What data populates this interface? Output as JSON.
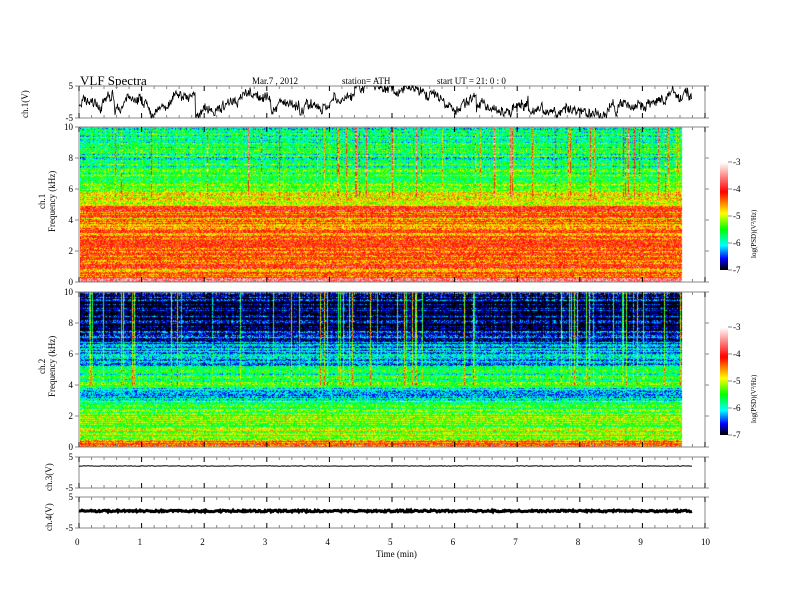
{
  "header": {
    "title": "VLF  Spectra",
    "date": "Mar.7  , 2012",
    "station": "station= ATH",
    "start": "start  UT  =    21: 0  : 0"
  },
  "chart_data": [
    {
      "type": "line",
      "name_label": "ch.1(V)",
      "ylabel": "ch.1(V)",
      "ylim": [
        -5,
        5
      ],
      "yticks": [
        "5",
        "-5"
      ],
      "xlim": [
        0,
        10
      ],
      "data_end_min": 9.8,
      "description_values": "waveform oscillating roughly between -5 and 5"
    },
    {
      "type": "heatmap",
      "ylabel": "ch.1\nFrequency  (kHz)",
      "ylabel_lines": [
        "ch.1",
        "Frequency  (kHz)"
      ],
      "ylim": [
        0,
        10
      ],
      "yticks": [
        "0",
        "2",
        "4",
        "6",
        "8",
        "10"
      ],
      "xlim": [
        0,
        10
      ],
      "data_end_min": 9.8,
      "colorbar": {
        "label": "log(PSD)(V²/Hz)",
        "range": [
          -7,
          -3
        ],
        "ticks": [
          "-3",
          "-4",
          "-5",
          "-6",
          "-7"
        ]
      },
      "mean_logpsd_by_freq_khz": {
        "freq": [
          0,
          0.3,
          0.6,
          1,
          2,
          3,
          4,
          4.7,
          5,
          5.5,
          6,
          7,
          8,
          9,
          10
        ],
        "logpsd": [
          -3.4,
          -4.0,
          -4.6,
          -4.2,
          -4.3,
          -4.4,
          -4.6,
          -4.05,
          -4.7,
          -5.0,
          -5.1,
          -5.5,
          -5.7,
          -5.8,
          -5.8
        ]
      }
    },
    {
      "type": "heatmap",
      "ylabel_lines": [
        "ch.2",
        "Frequency  (kHz)"
      ],
      "ylim": [
        0,
        10
      ],
      "yticks": [
        "0",
        "2",
        "4",
        "6",
        "8",
        "10"
      ],
      "xlim": [
        0,
        10
      ],
      "data_end_min": 9.8,
      "colorbar": {
        "label": "log(PSD)(V²/Hz)",
        "range": [
          -7,
          -3
        ],
        "ticks": [
          "-3",
          "-4",
          "-5",
          "-6",
          "-7"
        ]
      },
      "mean_logpsd_by_freq_khz": {
        "freq": [
          0,
          0.3,
          0.6,
          1,
          2,
          3,
          3.4,
          4,
          5,
          5.5,
          6,
          6.5,
          7,
          8,
          9,
          10
        ],
        "logpsd": [
          -4.6,
          -4.3,
          -5.3,
          -5.2,
          -5.4,
          -5.6,
          -6.4,
          -5.6,
          -5.8,
          -6.4,
          -6.0,
          -6.4,
          -6.6,
          -6.9,
          -6.9,
          -6.8
        ]
      }
    },
    {
      "type": "line",
      "ylabel": "ch.3(V)",
      "ylim": [
        -5,
        5
      ],
      "yticks": [
        "5",
        "-5"
      ],
      "level": 2.5,
      "data_end_min": 9.8
    },
    {
      "type": "line",
      "ylabel": "ch.4(V)",
      "ylim": [
        -5,
        5
      ],
      "yticks": [
        "5",
        "-5"
      ],
      "level": 0.5,
      "data_end_min": 9.8
    }
  ],
  "xaxis": {
    "label": "Time  (min)",
    "ticks": [
      "0",
      "1",
      "2",
      "3",
      "4",
      "5",
      "6",
      "7",
      "8",
      "9",
      "10"
    ]
  },
  "colors": {
    "cmap": [
      "#000000",
      "#0000ff",
      "#00ffff",
      "#00ff00",
      "#ffff00",
      "#ff0000",
      "#ffffff"
    ]
  }
}
